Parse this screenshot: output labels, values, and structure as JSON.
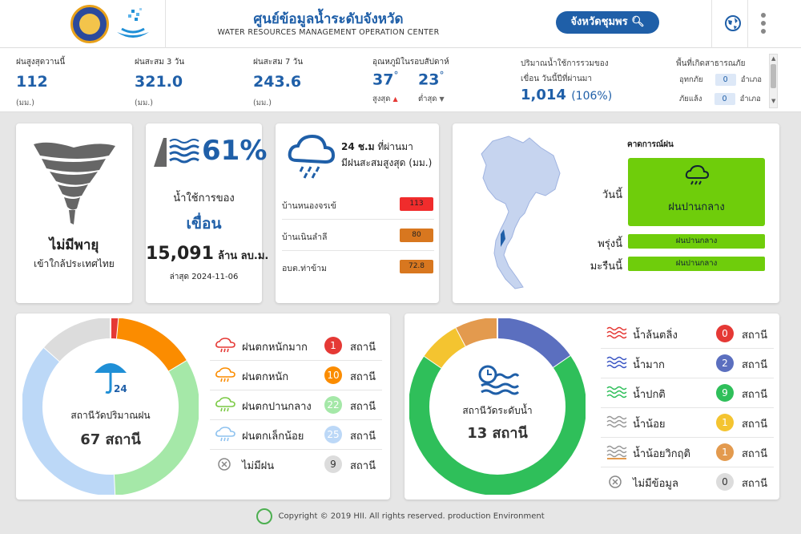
{
  "header": {
    "title_th": "ศูนย์ข้อมูลน้ำระดับจังหวัด",
    "title_en": "WATER RESOURCES MANAGEMENT OPERATION CENTER",
    "province_button": "จังหวัดชุมพร"
  },
  "stats": {
    "rain_today": {
      "label": "ฝนสูงสุดวานนี้",
      "value": "112",
      "unit": "(มม.)"
    },
    "rain_3d": {
      "label": "ฝนสะสม 3 วัน",
      "value": "321.0",
      "unit": "(มม.)"
    },
    "rain_7d": {
      "label": "ฝนสะสม 7 วัน",
      "value": "243.6",
      "unit": "(มม.)"
    },
    "temp": {
      "label": "อุณหภูมิในรอบสัปดาห์",
      "max": "37",
      "min": "23",
      "max_label": "สูงสุด",
      "min_label": "ต่ำสุด",
      "deg": "°"
    },
    "dam_usage": {
      "label1": "ปริมาณน้ำใช้การรวมของ",
      "label2": "เขื่อน วันนี้ปีที่ผ่านมา",
      "value": "1,014",
      "pct": "(106%)"
    },
    "disaster": {
      "label": "พื้นที่เกิดสาธารณภัย",
      "flood_label": "อุทกภัย",
      "flood_value": "0",
      "drought_label": "ภัยแล้ง",
      "drought_value": "0",
      "unit": "อำเภอ"
    }
  },
  "storm": {
    "title": "ไม่มีพายุ",
    "subtitle": "เข้าใกล้ประเทศไทย"
  },
  "dam": {
    "percent": "61%",
    "line1": "น้ำใช้การของ",
    "line2": "เขื่อน",
    "volume": "15,091",
    "volume_unit": "ล้าน ลบ.ม.",
    "updated": "ล่าสุด 2024-11-06"
  },
  "rain24": {
    "title1": "24 ชั่วโมงที่ผ่านมา",
    "title1_bold": "24 ช.ม",
    "title1_rest": "ที่ผ่านมา",
    "title2": "มีฝนสะสมสูงสุด (มม.)",
    "rows": [
      {
        "name": "บ้านหนองจรเข้",
        "value": "113",
        "color": "#f02c2c"
      },
      {
        "name": "บ้านเนินลำลี",
        "value": "80",
        "color": "#d8771f"
      },
      {
        "name": "อบต.ท่าข้าม",
        "value": "72.8",
        "color": "#d8771f"
      }
    ]
  },
  "forecast": {
    "title": "คาดการณ์ฝน",
    "today_label": "วันนี้",
    "today_value": "ฝนปานกลาง",
    "tomorrow_label": "พรุ่งนี้",
    "tomorrow_value": "ฝนปานกลาง",
    "dayafter_label": "มะรืนนี้",
    "dayafter_value": "ฝนปานกลาง",
    "color": "#6fcd0b"
  },
  "rainfall_stations": {
    "center_label": "สถานีวัดปริมาณฝน",
    "center_count": "67 สถานี",
    "icon_text": "24",
    "unit": "สถานี",
    "items": [
      {
        "label": "ฝนตกหนักมาก",
        "count": 1,
        "color": "#e53935"
      },
      {
        "label": "ฝนตกหนัก",
        "count": 10,
        "color": "#fb8c00"
      },
      {
        "label": "ฝนตกปานกลาง",
        "count": 22,
        "color": "#a5e8a8"
      },
      {
        "label": "ฝนตกเล็กน้อย",
        "count": 25,
        "color": "#bcd8f7"
      },
      {
        "label": "ไม่มีฝน",
        "count": 9,
        "color": "#dcdcdc"
      }
    ]
  },
  "water_stations": {
    "center_label": "สถานีวัดระดับน้ำ",
    "center_count": "13 สถานี",
    "unit": "สถานี",
    "items": [
      {
        "label": "น้ำล้นตลิ่ง",
        "count": 0,
        "color": "#e53935"
      },
      {
        "label": "น้ำมาก",
        "count": 2,
        "color": "#5b6fbf"
      },
      {
        "label": "น้ำปกติ",
        "count": 9,
        "color": "#2fbf5a"
      },
      {
        "label": "น้ำน้อย",
        "count": 1,
        "color": "#f4c430"
      },
      {
        "label": "น้ำน้อยวิกฤติ",
        "count": 1,
        "color": "#e39a4e"
      },
      {
        "label": "ไม่มีข้อมูล",
        "count": 0,
        "color": "#dcdcdc"
      }
    ]
  },
  "footer": "Copyright © 2019 HII. All rights reserved. production Environment"
}
